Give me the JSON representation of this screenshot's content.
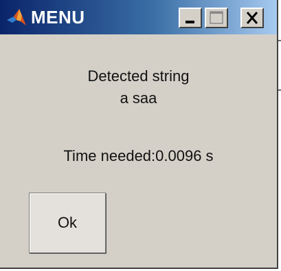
{
  "window": {
    "title": "MENU",
    "icon": "matlab-logo-icon",
    "controls": {
      "minimize": "minimize-icon",
      "maximize": "maximize-icon",
      "close": "close-icon"
    }
  },
  "message": {
    "line1": "Detected string",
    "line2": "a saa",
    "line3": "Time needed:0.0096 s"
  },
  "buttons": {
    "ok_label": "Ok"
  },
  "colors": {
    "window_bg": "#d4d0c8",
    "titlebar_start": "#0a246a",
    "titlebar_end": "#a6caf0",
    "title_text": "#ffffff"
  }
}
